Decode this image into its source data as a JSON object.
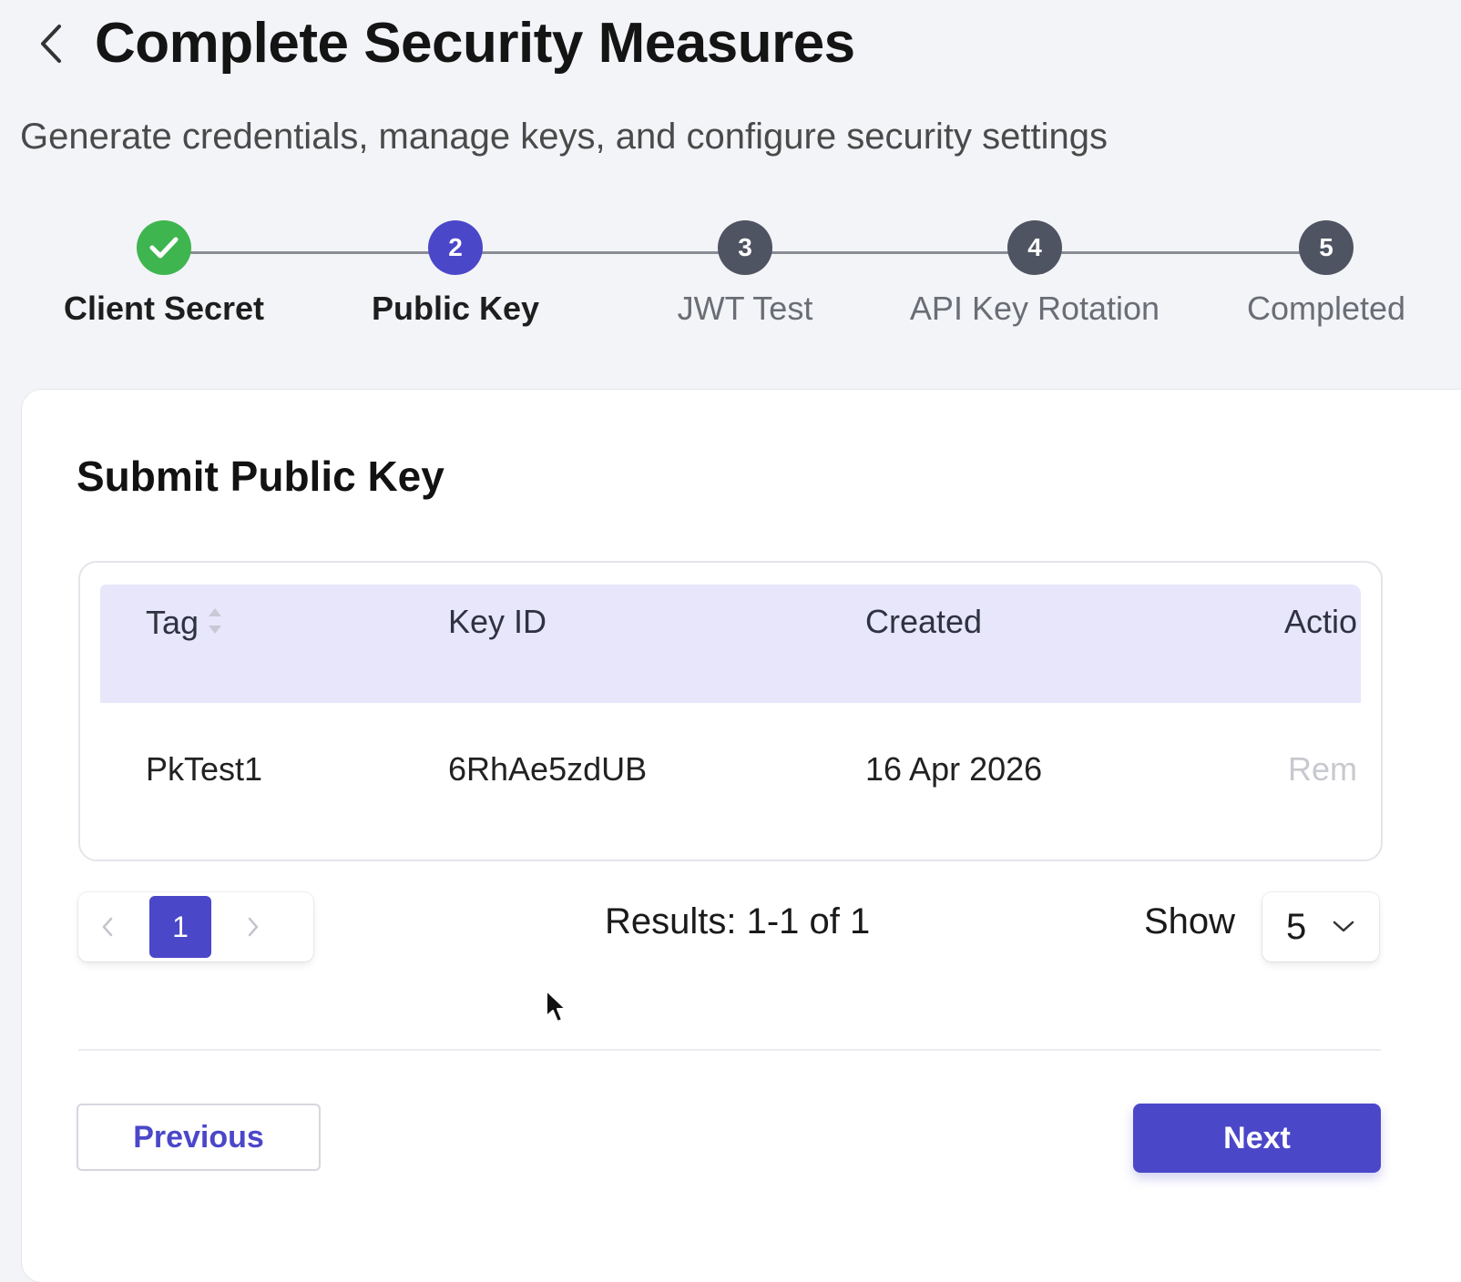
{
  "header": {
    "title": "Complete Security Measures",
    "subtitle": "Generate credentials, manage keys, and configure security settings",
    "back_icon": "chevron-left-icon"
  },
  "stepper": {
    "steps": [
      {
        "number": "1",
        "label": "Client Secret",
        "state": "done",
        "icon": "check-icon"
      },
      {
        "number": "2",
        "label": "Public Key",
        "state": "active"
      },
      {
        "number": "3",
        "label": "JWT Test",
        "state": "pending"
      },
      {
        "number": "4",
        "label": "API Key Rotation",
        "state": "pending"
      },
      {
        "number": "5",
        "label": "Completed",
        "state": "pending"
      }
    ]
  },
  "card": {
    "title": "Submit Public Key",
    "table": {
      "columns": [
        "Tag",
        "Key ID",
        "Created",
        "Actio"
      ],
      "rows": [
        {
          "tag": "PkTest1",
          "key_id": "6RhAe5zdUB",
          "created": "16 Apr 2026",
          "action": "Rem"
        }
      ]
    },
    "pagination": {
      "current_page": "1",
      "prev_icon": "chevron-left-icon",
      "next_icon": "chevron-right-icon",
      "results_text": "Results: 1-1 of 1",
      "show_label": "Show",
      "page_size": "5"
    },
    "buttons": {
      "previous": "Previous",
      "next": "Next"
    }
  },
  "colors": {
    "accent": "#4b47c9",
    "success": "#3fb550",
    "pending": "#4f5462",
    "table_header_bg": "#e7e6fb"
  }
}
